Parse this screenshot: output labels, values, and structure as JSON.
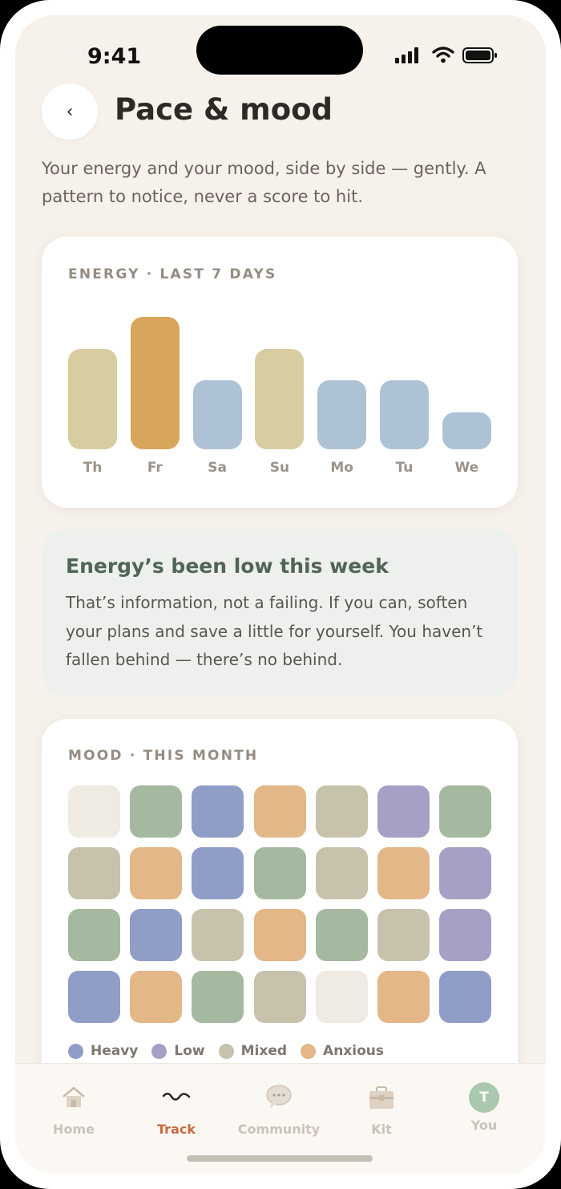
{
  "status": {
    "time": "9:41"
  },
  "header": {
    "back_icon": "chevron-left-icon",
    "back_glyph": "‹",
    "title": "Pace & mood"
  },
  "intro": "Your energy and your mood, side by side — gently. A pattern to notice, never a score to hit.",
  "energy": {
    "label": "ENERGY · LAST 7 DAYS",
    "days": [
      {
        "day": "Th",
        "level": 0.76,
        "color": "#d8cca1"
      },
      {
        "day": "Fr",
        "level": 1.0,
        "color": "#d8a55c"
      },
      {
        "day": "Sa",
        "level": 0.52,
        "color": "#aec2d6"
      },
      {
        "day": "Su",
        "level": 0.76,
        "color": "#d8cca1"
      },
      {
        "day": "Mo",
        "level": 0.52,
        "color": "#aec2d6"
      },
      {
        "day": "Tu",
        "level": 0.52,
        "color": "#aec2d6"
      },
      {
        "day": "We",
        "level": 0.28,
        "color": "#aec2d6"
      }
    ]
  },
  "note": {
    "title": "Energy’s been low this week",
    "body": "That’s information, not a failing. If you can, soften your plans and save a little for yourself. You haven’t fallen behind — there’s no behind."
  },
  "mood": {
    "label": "MOOD · THIS MONTH",
    "colors": {
      "none": "#efeae2",
      "calm": "#a5b9a0",
      "heavy": "#8f9dc7",
      "anxious": "#e3b787",
      "mixed": "#c7c2ab",
      "low": "#a5a0c6"
    },
    "grid": [
      [
        "none",
        "calm",
        "heavy",
        "anxious",
        "mixed",
        "low",
        "calm"
      ],
      [
        "mixed",
        "anxious",
        "heavy",
        "calm",
        "mixed",
        "anxious",
        "low"
      ],
      [
        "calm",
        "heavy",
        "mixed",
        "anxious",
        "calm",
        "mixed",
        "low"
      ],
      [
        "heavy",
        "anxious",
        "calm",
        "mixed",
        "none",
        "anxious",
        "heavy"
      ]
    ],
    "legend": [
      {
        "label": "Heavy",
        "key": "heavy"
      },
      {
        "label": "Low",
        "key": "low"
      },
      {
        "label": "Mixed",
        "key": "mixed"
      },
      {
        "label": "Anxious",
        "key": "anxious"
      }
    ]
  },
  "tabs": [
    {
      "label": "Home",
      "icon": "house-icon"
    },
    {
      "label": "Track",
      "icon": "wave-icon",
      "active": true
    },
    {
      "label": "Community",
      "icon": "chat-bubble-icon"
    },
    {
      "label": "Kit",
      "icon": "toolbox-icon"
    },
    {
      "label": "You",
      "icon": "avatar-icon",
      "initial": "T"
    }
  ],
  "theme": {
    "accent": "#c96a3b",
    "background": "#f6f1ea",
    "note_title": "#506556"
  }
}
